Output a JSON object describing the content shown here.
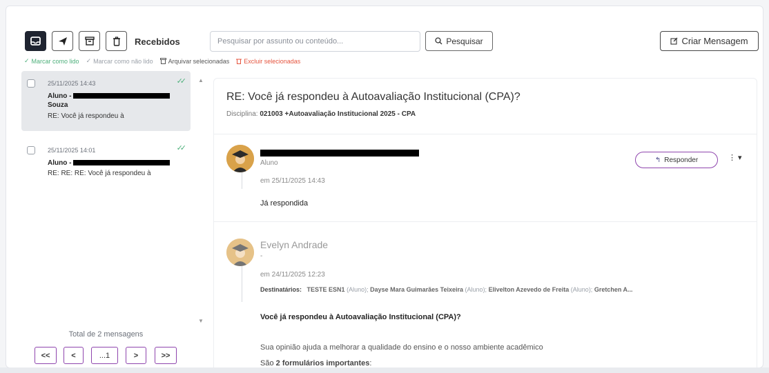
{
  "toolbar": {
    "folder_label": "Recebidos",
    "search_placeholder": "Pesquisar por assunto ou conteúdo...",
    "search_button": "Pesquisar",
    "create_button": "Criar Mensagem"
  },
  "actions": {
    "mark_read": "Marcar como lido",
    "mark_unread": "Marcar como não lido",
    "archive": "Arquivar selecionadas",
    "delete": "Excluir selecionadas"
  },
  "messages": [
    {
      "date": "25/11/2025 14:43",
      "sender_prefix": "Aluno -",
      "sender_suffix": "Souza",
      "subject": "RE: Você já respondeu à",
      "selected": true
    },
    {
      "date": "25/11/2025 14:01",
      "sender_prefix": "Aluno -",
      "sender_suffix": "",
      "subject": "RE: RE: RE: Você já respondeu à",
      "selected": false
    }
  ],
  "pagination": {
    "total": "Total de 2 mensagens",
    "first": "<<",
    "prev": "<",
    "page": "...1",
    "next": ">",
    "last": ">>"
  },
  "reading": {
    "subject": "RE: Você já respondeu à Autoavaliação Institucional (CPA)?",
    "discipline_label": "Disciplina:",
    "discipline_value": "021003 +Autoavaliação Institucional 2025 - CPA",
    "reply_button": "Responder",
    "first_message": {
      "role": "Aluno",
      "date": "em 25/11/2025 14:43",
      "body": "Já respondida"
    },
    "second_message": {
      "name": "Evelyn Andrade",
      "role": "-",
      "date": "em 24/11/2025 12:23",
      "recipients_label": "Destinatários:",
      "recipients": [
        {
          "name": "TESTE ESN1",
          "role": "(Aluno);"
        },
        {
          "name": "Dayse Mara Guimarães Teixeira",
          "role": "(Aluno);"
        },
        {
          "name": "Elivelton Azevedo de Freita",
          "role": "(Aluno);"
        },
        {
          "name": "Gretchen A...",
          "role": ""
        }
      ],
      "body_title": "Você já respondeu à Autoavaliação Institucional (CPA)?",
      "body_line1": "Sua opinião ajuda a melhorar a qualidade do ensino e o nosso ambiente acadêmico",
      "body_line2_prefix": "São ",
      "body_line2_bold": "2 formulários importantes",
      "body_line2_suffix": ":"
    }
  },
  "colors": {
    "accent": "#8e44ad",
    "success": "#4caf7a",
    "danger": "#e5533d",
    "dark": "#1f2430"
  }
}
